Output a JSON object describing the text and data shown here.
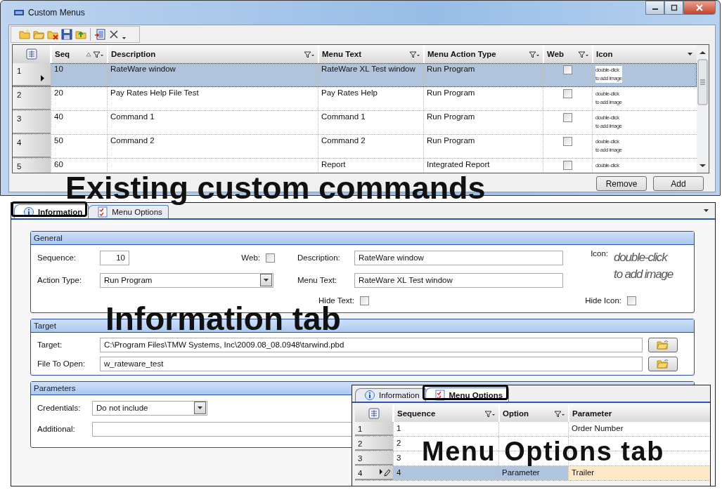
{
  "window": {
    "title": "Custom Menus"
  },
  "grid": {
    "columns": [
      {
        "label": "Seq",
        "kind": "text",
        "sorted": true,
        "filter": true
      },
      {
        "label": "Description",
        "kind": "text",
        "filter": true
      },
      {
        "label": "Menu Text",
        "kind": "text",
        "filter": true
      },
      {
        "label": "Menu Action Type",
        "kind": "text",
        "filter": true
      },
      {
        "label": "Web",
        "kind": "checkbox",
        "filter": true
      },
      {
        "label": "Icon",
        "kind": "image",
        "filter": false
      }
    ],
    "rows": [
      {
        "number": "1",
        "cells": [
          "10",
          "RateWare window",
          "RateWare XL Test window",
          "Run Program"
        ],
        "web": false,
        "icon_hint": [
          "double-click",
          "to add image"
        ],
        "selected": true
      },
      {
        "number": "2",
        "cells": [
          "20",
          "Pay Rates Help File Test",
          "Pay Rates Help",
          "Run Program"
        ],
        "web": false,
        "icon_hint": [
          "double-click",
          "to add image"
        ],
        "selected": false
      },
      {
        "number": "3",
        "cells": [
          "40",
          "Command 1",
          "Command 1",
          "Run Program"
        ],
        "web": false,
        "icon_hint": [
          "double-click",
          "to add image"
        ],
        "selected": false
      },
      {
        "number": "4",
        "cells": [
          "50",
          "Command 2",
          "Command 2",
          "Run Program"
        ],
        "web": false,
        "icon_hint": [
          "double-click",
          "to add image"
        ],
        "selected": false
      },
      {
        "number": "5",
        "cells": [
          "60",
          null,
          "Report",
          "Integrated Report"
        ],
        "web": false,
        "icon_hint": [
          "double-click"
        ],
        "selected": false
      }
    ]
  },
  "buttons": [
    "Remove",
    "Add"
  ],
  "detail": {
    "tabs": [
      {
        "label": "Information",
        "selected": true,
        "callout": true
      },
      {
        "label": "Menu Options",
        "selected": false,
        "callout": false
      }
    ],
    "general": {
      "title": "General",
      "sequence_label": "Sequence:",
      "sequence": "10",
      "web_label": "Web:",
      "web": false,
      "action_type_label": "Action Type:",
      "action_type": "Run Program",
      "description_label": "Description:",
      "description": "RateWare window",
      "menu_text_label": "Menu Text:",
      "menu_text": "RateWare XL Test window",
      "hide_text_label": "Hide Text:",
      "hide_text": false,
      "icon_label": "Icon:",
      "icon_hint": [
        "double-click",
        "to add image"
      ],
      "hide_icon_label": "Hide Icon:",
      "hide_icon": false
    },
    "target": {
      "title": "Target",
      "target_label": "Target:",
      "target": "C:\\Program Files\\TMW Systems, Inc\\2009.08_08.0948\\tarwind.pbd",
      "file_label": "File To Open:",
      "file": "w_rateware_test"
    },
    "parameters": {
      "title": "Parameters",
      "credentials_label": "Credentials:",
      "credentials": "Do not include",
      "additional_label": "Additional:"
    }
  },
  "menu_options": {
    "tabs": [
      {
        "label": "Information",
        "selected": false,
        "callout": false
      },
      {
        "label": "Menu Options",
        "selected": true,
        "callout": true
      }
    ],
    "columns": [
      {
        "label": "Sequence",
        "filter": true
      },
      {
        "label": "Option",
        "filter": true
      },
      {
        "label": "Parameter",
        "filter": false
      }
    ],
    "rows": [
      {
        "number": "1",
        "sequence": "1",
        "parameter": "Order Number",
        "selected": false,
        "editing": false
      },
      {
        "number": "2",
        "sequence": "2",
        "selected": false,
        "editing": false
      },
      {
        "number": "3",
        "sequence": "3",
        "selected": false,
        "editing": false
      },
      {
        "number": "4",
        "sequence": "4",
        "option": "Parameter",
        "parameter": "Trailer",
        "selected": true,
        "editing": true
      }
    ]
  },
  "annotations": [
    {
      "text": "Existing custom commands"
    },
    {
      "text": "Information tab"
    },
    {
      "text": "Menu Options tab"
    }
  ]
}
